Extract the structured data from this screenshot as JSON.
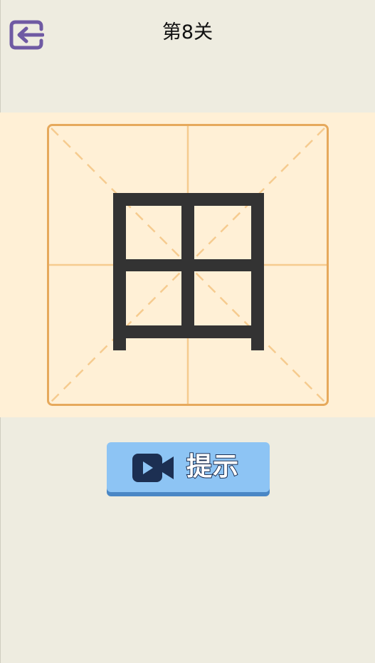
{
  "header": {
    "title": "第8关",
    "back_icon": "exit-arrow-icon"
  },
  "puzzle": {
    "character": "田",
    "grid_style": "米字格",
    "colors": {
      "background": "#fff0d6",
      "grid_border": "#e6a95c",
      "grid_lines": "#f6cb8f",
      "strokes": "#333333"
    }
  },
  "hint": {
    "label": "提示",
    "icon": "video-camera-icon",
    "color": "#8dc4f4"
  }
}
